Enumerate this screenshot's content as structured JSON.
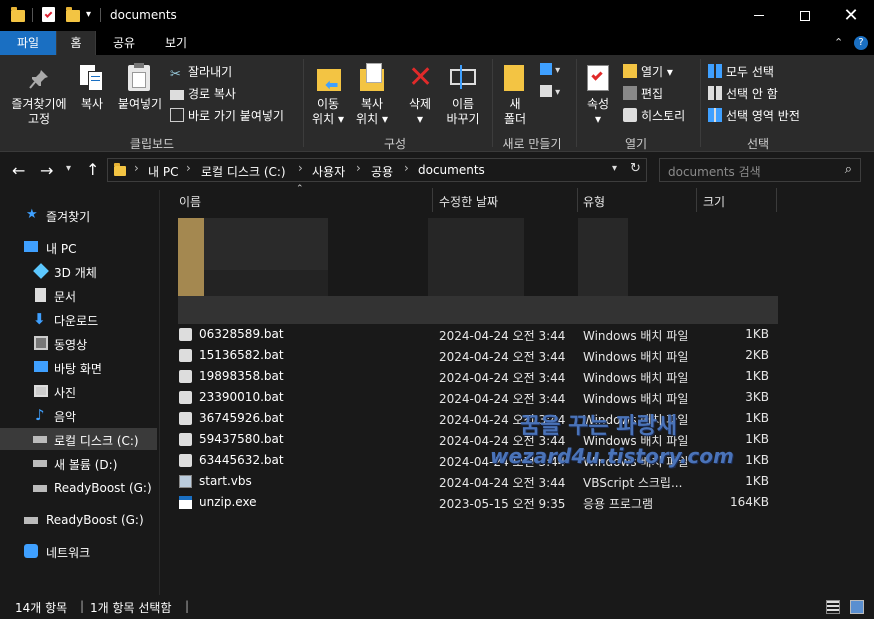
{
  "window": {
    "title": "documents"
  },
  "tabs": [
    {
      "label": "파일"
    },
    {
      "label": "홈"
    },
    {
      "label": "공유"
    },
    {
      "label": "보기"
    }
  ],
  "ribbon": {
    "clipboard": {
      "pin_line1": "즐겨찾기에",
      "pin_line2": "고정",
      "copy": "복사",
      "paste": "붙여넣기",
      "cut": "잘라내기",
      "copy_path": "경로 복사",
      "paste_shortcut": "바로 가기 붙여넣기",
      "group": "클립보드"
    },
    "organize": {
      "move_line1": "이동",
      "move_line2": "위치",
      "copyto_line1": "복사",
      "copyto_line2": "위치",
      "delete": "삭제",
      "rename_line1": "이름",
      "rename_line2": "바꾸기",
      "group": "구성"
    },
    "new": {
      "folder_line1": "새",
      "folder_line2": "폴더",
      "group": "새로 만들기"
    },
    "open": {
      "properties": "속성",
      "open": "열기",
      "edit": "편집",
      "history": "히스토리",
      "group": "열기"
    },
    "select": {
      "all": "모두 선택",
      "none": "선택 안 함",
      "invert": "선택 영역 반전",
      "group": "선택"
    }
  },
  "address": {
    "crumbs": [
      "내 PC",
      "로컬 디스크 (C:)",
      "사용자",
      "공용",
      "documents"
    ],
    "search_placeholder": "documents 검색"
  },
  "sidebar": {
    "quick_access": "즐겨찾기",
    "this_pc": "내 PC",
    "objects_3d": "3D 개체",
    "documents": "문서",
    "downloads": "다운로드",
    "videos": "동영상",
    "desktop": "바탕 화면",
    "pictures": "사진",
    "music": "음악",
    "local_disk": "로컬 디스크 (C:)",
    "new_volume": "새 볼륨 (D:)",
    "readyboost_sub": "ReadyBoost (G:)",
    "readyboost": "ReadyBoost (G:)",
    "network": "네트워크"
  },
  "columns": {
    "name": "이름",
    "modified": "수정한 날짜",
    "type": "유형",
    "size": "크기"
  },
  "files": [
    {
      "name": "06328589.bat",
      "date": "2024-04-24 오전 3:44",
      "type": "Windows 배치 파일",
      "size": "1KB",
      "icon": "bat-file-icon"
    },
    {
      "name": "15136582.bat",
      "date": "2024-04-24 오전 3:44",
      "type": "Windows 배치 파일",
      "size": "2KB",
      "icon": "bat-file-icon"
    },
    {
      "name": "19898358.bat",
      "date": "2024-04-24 오전 3:44",
      "type": "Windows 배치 파일",
      "size": "1KB",
      "icon": "bat-file-icon"
    },
    {
      "name": "23390010.bat",
      "date": "2024-04-24 오전 3:44",
      "type": "Windows 배치 파일",
      "size": "3KB",
      "icon": "bat-file-icon"
    },
    {
      "name": "36745926.bat",
      "date": "2024-04-24 오전 3:44",
      "type": "Windows 배치 파일",
      "size": "1KB",
      "icon": "bat-file-icon"
    },
    {
      "name": "59437580.bat",
      "date": "2024-04-24 오전 3:44",
      "type": "Windows 배치 파일",
      "size": "1KB",
      "icon": "bat-file-icon"
    },
    {
      "name": "63445632.bat",
      "date": "2024-04-24 오전 3:44",
      "type": "Windows 배치 파일",
      "size": "1KB",
      "icon": "bat-file-icon"
    },
    {
      "name": "start.vbs",
      "date": "2024-04-24 오전 3:44",
      "type": "VBScript 스크립...",
      "size": "1KB",
      "icon": "vbs-file-icon"
    },
    {
      "name": "unzip.exe",
      "date": "2023-05-15 오전 9:35",
      "type": "응용 프로그램",
      "size": "164KB",
      "icon": "exe-file-icon"
    }
  ],
  "watermark": {
    "line1": "꿈을 꾸는 파랑새",
    "line2": "wezard4u.tistory.com"
  },
  "status": {
    "count": "14개 항목",
    "selected": "1개 항목 선택함"
  },
  "colors": {
    "accent": "#1a6fc2",
    "folder": "#f3c443",
    "background": "#191919"
  }
}
